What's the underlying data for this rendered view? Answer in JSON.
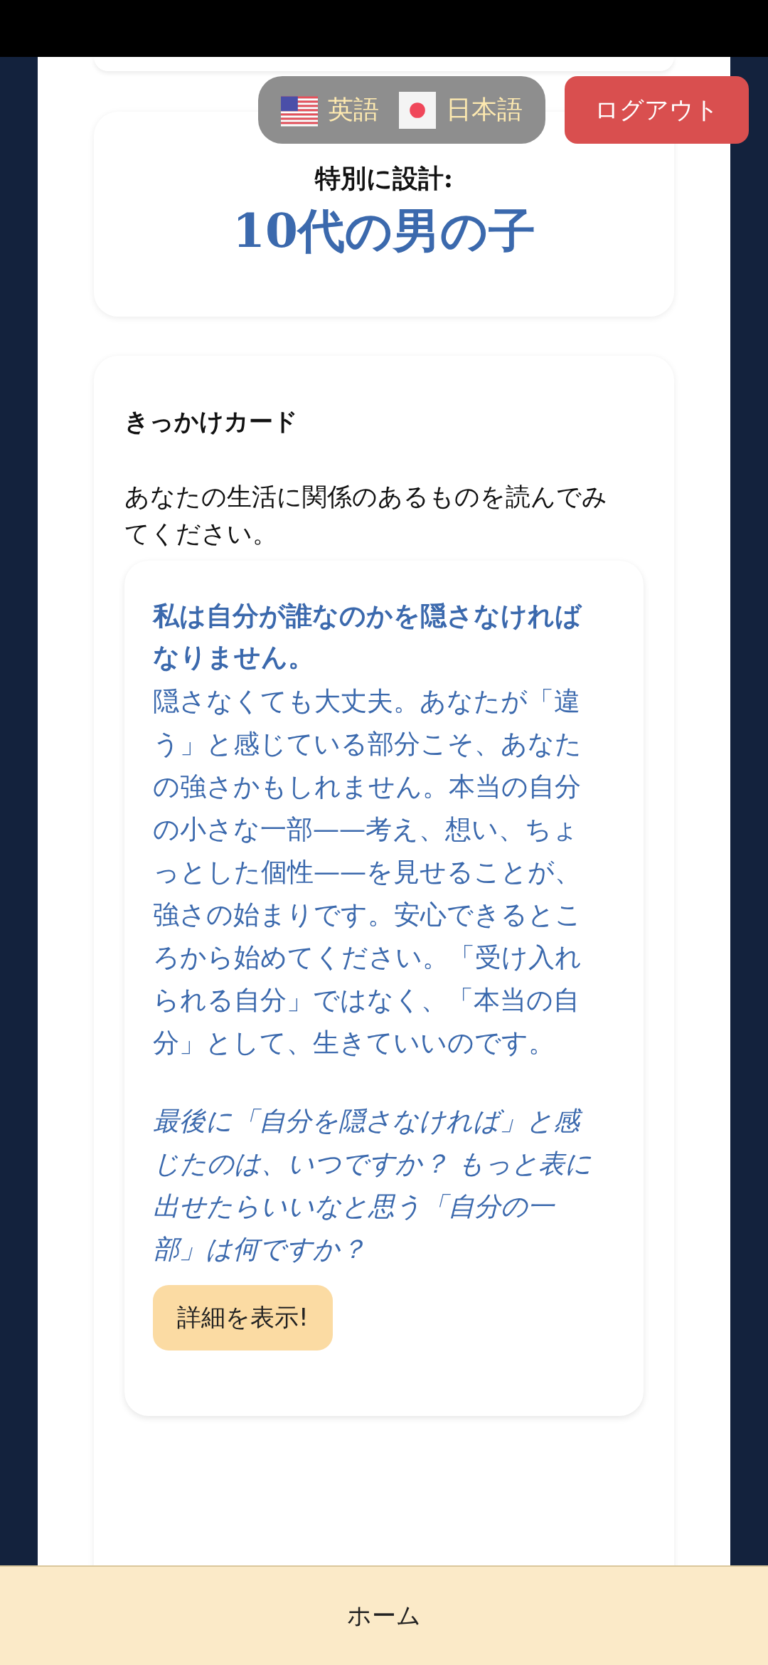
{
  "header": {
    "languages": [
      {
        "label": "英語",
        "kind": "us"
      },
      {
        "label": "日本語",
        "kind": "jp"
      }
    ],
    "logout": "ログアウト"
  },
  "intro_card": {
    "label": "特別に設計:",
    "audience": "10代の男の子"
  },
  "prompt_section": {
    "title": "きっかけカード",
    "instructions": "あなたの生活に関係のあるものを読んでみてください。",
    "cards": [
      {
        "title": "私は自分が誰なのかを隠さなければなりません。",
        "body": "隠さなくても大丈夫。あなたが「違う」と感じている部分こそ、あなたの強さかもしれません。本当の自分の小さな一部——考え、想い、ちょっとした個性——を見せることが、強さの始まりです。安心できるところから始めてください。「受け入れられる自分」ではなく、「本当の自分」として、生きていいのです。",
        "question": "最後に「自分を隠さなければ」と感じたのは、いつですか？ もっと表に出せたらいいなと思う「自分の一部」は何ですか？",
        "button": "詳細を表示!"
      }
    ]
  },
  "bottom_nav": {
    "items": [
      "ホーム"
    ]
  }
}
